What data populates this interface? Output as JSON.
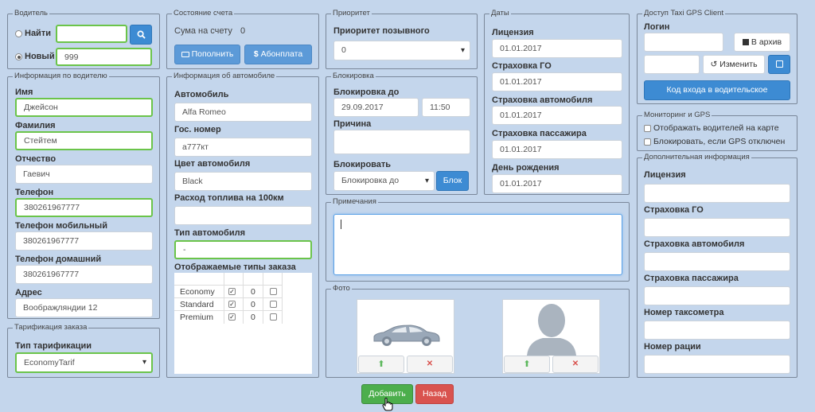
{
  "driver": {
    "legend": "Водитель",
    "find_label": "Найти",
    "find_value": "",
    "new_label": "Новый",
    "new_value": "999"
  },
  "driver_info": {
    "legend": "Информация по водителю",
    "name_label": "Имя",
    "name": "Джейсон",
    "surname_label": "Фамилия",
    "surname": "Стейтем",
    "patronymic_label": "Отчество",
    "patronymic": "Гаевич",
    "phone_label": "Телефон",
    "phone": "380261967777",
    "mobile_label": "Телефон мобильный",
    "mobile": "380261967777",
    "home_label": "Телефон домашний",
    "home": "380261967777",
    "address_label": "Адрес",
    "address": "Вообраҗляндии 12"
  },
  "tariff": {
    "legend": "Тарификация заказа",
    "type_label": "Тип тарификации",
    "type_value": "EconomyTarif"
  },
  "account": {
    "legend": "Состояние счета",
    "sum_label": "Сума на счету",
    "sum_value": "0",
    "topup_label": "Пополнить",
    "subscription_label": "Абонплата"
  },
  "car": {
    "legend": "Информация об автомобиле",
    "car_label": "Автомобиль",
    "car": "Alfa Romeo",
    "plate_label": "Гос. номер",
    "plate": "а777кт",
    "color_label": "Цвет автомобиля",
    "color": "Black",
    "fuel_label": "Расход топлива на 100км",
    "fuel": "",
    "type_label": "Тип автомобиля",
    "type": "-",
    "order_types_label": "Отображаемые типы заказа",
    "order_types": [
      {
        "name": "Economy",
        "count": "0"
      },
      {
        "name": "Standard",
        "count": "0"
      },
      {
        "name": "Premium",
        "count": "0"
      }
    ]
  },
  "priority": {
    "legend": "Приоритет",
    "label": "Приоритет позывного",
    "value": "0"
  },
  "block": {
    "legend": "Блокировка",
    "until_label": "Блокировка до",
    "date": "29.09.2017",
    "time": "11:50",
    "reason_label": "Причина",
    "reason": "",
    "block_label": "Блокировать",
    "block_value": "Блокировка до",
    "block_btn": "Блок"
  },
  "notes": {
    "legend": "Примечания",
    "value": ""
  },
  "photo": {
    "legend": "Фото"
  },
  "dates": {
    "legend": "Даты",
    "license_label": "Лицензия",
    "license": "01.01.2017",
    "go_label": "Страховка ГО",
    "go": "01.01.2017",
    "car_ins_label": "Страховка автомобиля",
    "car_ins": "01.01.2017",
    "pass_ins_label": "Страховка пассажира",
    "pass_ins": "01.01.2017",
    "birthday_label": "День рождения",
    "birthday": "01.01.2017"
  },
  "gps_client": {
    "legend": "Доступ Taxi GPS Client",
    "login_label": "Логин",
    "login": "",
    "archive_label": "В архив",
    "password": "",
    "change_label": "Изменить",
    "code_btn": "Код входа в водительское"
  },
  "monitoring": {
    "legend": "Мониторинг и GPS",
    "show_on_map": "Отображать водителей на карте",
    "block_gps": "Блокировать, если GPS отключен"
  },
  "extra": {
    "legend": "Дополнительная информация",
    "license_label": "Лицензия",
    "go_label": "Страховка ГО",
    "car_ins_label": "Страховка автомобиля",
    "pass_ins_label": "Страховка пассажира",
    "taximeter_label": "Номер таксометра",
    "radio_label": "Номер рации"
  },
  "actions": {
    "add": "Добавить",
    "back": "Назад"
  },
  "colors": {
    "background": "#c4d6ec",
    "primary": "#3d8bd3",
    "success": "#4cae4c",
    "danger": "#d9534f",
    "focus_border": "#6bc44a"
  }
}
